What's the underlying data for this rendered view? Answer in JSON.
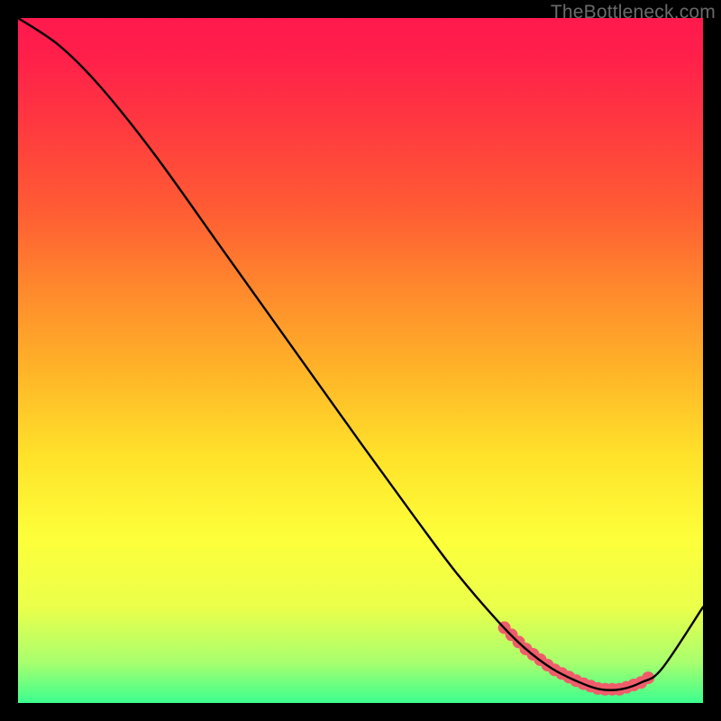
{
  "watermark": "TheBottleneck.com",
  "chart_data": {
    "type": "line",
    "title": "",
    "xlabel": "",
    "ylabel": "",
    "xlim": [
      0,
      100
    ],
    "ylim": [
      0,
      100
    ],
    "series": [
      {
        "name": "curve",
        "x": [
          0,
          6,
          12,
          20,
          30,
          40,
          50,
          58,
          64,
          70,
          74,
          78,
          82,
          85,
          88,
          91,
          94,
          100
        ],
        "values": [
          100,
          96,
          90,
          80,
          66,
          52,
          38,
          27,
          19,
          12,
          8,
          5,
          3,
          2,
          2,
          3,
          5,
          14
        ]
      }
    ],
    "highlight_band_x": [
      71,
      92
    ],
    "highlight_color": "#ef5d6b",
    "curve_color": "#000000"
  }
}
